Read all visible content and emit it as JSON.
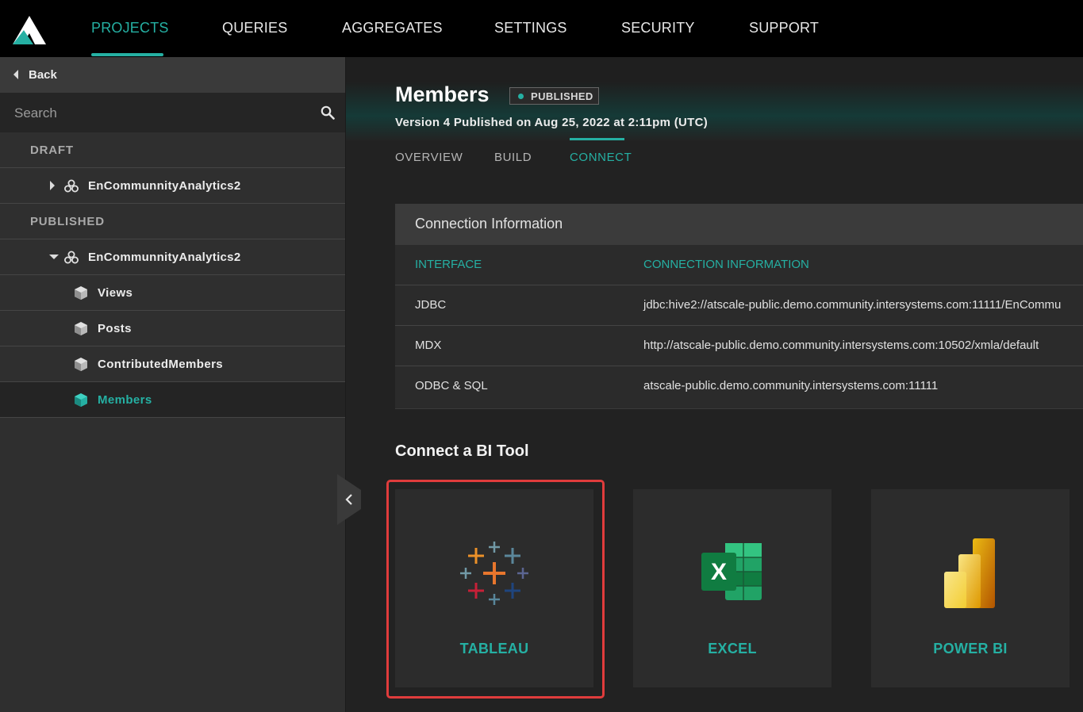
{
  "nav": {
    "items": [
      "PROJECTS",
      "QUERIES",
      "AGGREGATES",
      "SETTINGS",
      "SECURITY",
      "SUPPORT"
    ],
    "active": "PROJECTS",
    "accent": "#25b0a3"
  },
  "sidebar": {
    "back_label": "Back",
    "search_placeholder": "Search",
    "draft_label": "DRAFT",
    "draft_project": "EnCommunnityAnalytics2",
    "published_label": "PUBLISHED",
    "published_project": "EnCommunnityAnalytics2",
    "cubes": [
      "Views",
      "Posts",
      "ContributedMembers",
      "Members"
    ],
    "selected_cube": "Members"
  },
  "page": {
    "title": "Members",
    "badge": "PUBLISHED",
    "version_text": "Version 4 Published on Aug 25, 2022 at 2:11pm (UTC)",
    "tabs": [
      "OVERVIEW",
      "BUILD",
      "CONNECT"
    ],
    "active_tab": "CONNECT"
  },
  "connection": {
    "title": "Connection Information",
    "columns": [
      "INTERFACE",
      "CONNECTION INFORMATION"
    ],
    "rows": [
      [
        "JDBC",
        "jdbc:hive2://atscale-public.demo.community.intersystems.com:11111/EnCommu"
      ],
      [
        "MDX",
        "http://atscale-public.demo.community.intersystems.com:10502/xmla/default"
      ],
      [
        "ODBC & SQL",
        "atscale-public.demo.community.intersystems.com:11111"
      ]
    ]
  },
  "bi_tools": {
    "title": "Connect a BI Tool",
    "tools": [
      {
        "label": "TABLEAU",
        "icon": "tableau-logo-icon"
      },
      {
        "label": "EXCEL",
        "icon": "excel-logo-icon"
      },
      {
        "label": "POWER BI",
        "icon": "power-bi-logo-icon"
      }
    ],
    "highlight_color": "#e03c3c"
  }
}
